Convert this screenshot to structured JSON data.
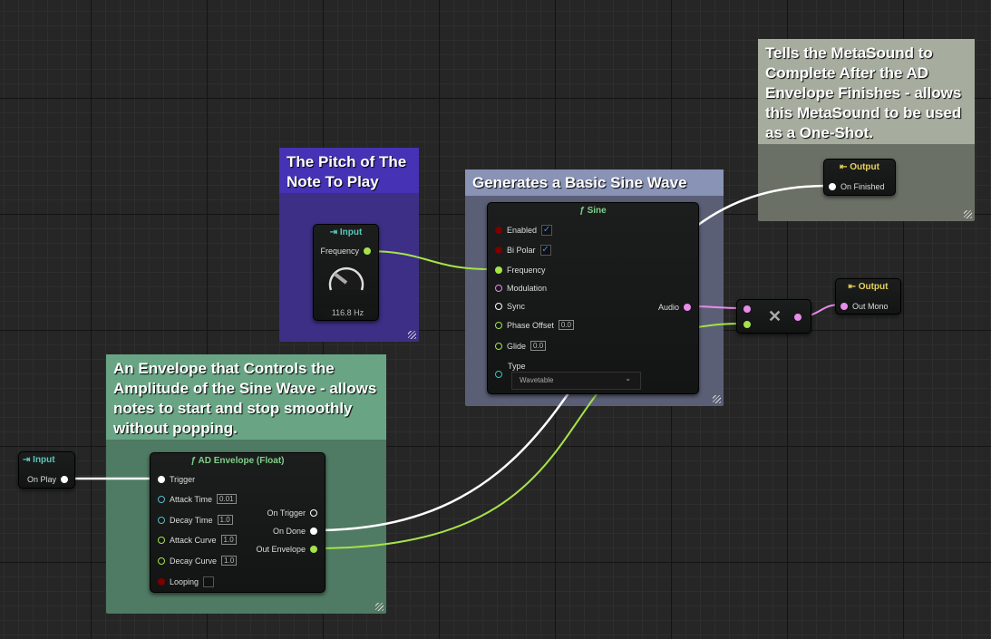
{
  "comments": {
    "pitch": "The Pitch of The Note To Play",
    "sine": "Generates a Basic Sine Wave",
    "complete": "Tells the MetaSound to Complete After the AD Envelope Finishes - allows this MetaSound to be used as a One-Shot.",
    "envelope": "An Envelope that Controls the Amplitude of the Sine Wave - allows notes to start and stop smoothly without popping."
  },
  "freq_input": {
    "title": "Input",
    "pin": "Frequency",
    "knob_value": "116.8 Hz",
    "icon": "input-icon"
  },
  "play_input": {
    "title": "Input",
    "pin": "On Play"
  },
  "sine": {
    "title": "ƒ Sine",
    "inputs": [
      "Enabled",
      "Bi Polar",
      "Frequency",
      "Modulation",
      "Sync",
      "Phase Offset",
      "Glide",
      "Type"
    ],
    "phase_offset": "0.0",
    "glide": "0.0",
    "type_value": "Wavetable",
    "output": "Audio",
    "enabled": true,
    "bipolar": true
  },
  "envelope": {
    "title": "ƒ AD Envelope (Float)",
    "inputs": [
      "Trigger",
      "Attack Time",
      "Decay Time",
      "Attack Curve",
      "Decay Curve",
      "Looping"
    ],
    "attack_time": "0.01",
    "decay_time": "1.0",
    "attack_curve": "1.0",
    "decay_curve": "1.0",
    "outputs": [
      "On Trigger",
      "On Done",
      "Out Envelope"
    ]
  },
  "multiply": {
    "symbol": "✕"
  },
  "out_finished": {
    "title": "Output",
    "pin": "On Finished"
  },
  "out_mono": {
    "title": "Output",
    "pin": "Out Mono"
  },
  "colors": {
    "float": "#a6e34a",
    "audio": "#e88de8",
    "trigger": "#ffffff",
    "int": "#5bb8c9",
    "bool": "#7a0000",
    "input_title": "#58c7b8",
    "output_title": "#e6d25a",
    "function_title": "#7fd08a"
  }
}
